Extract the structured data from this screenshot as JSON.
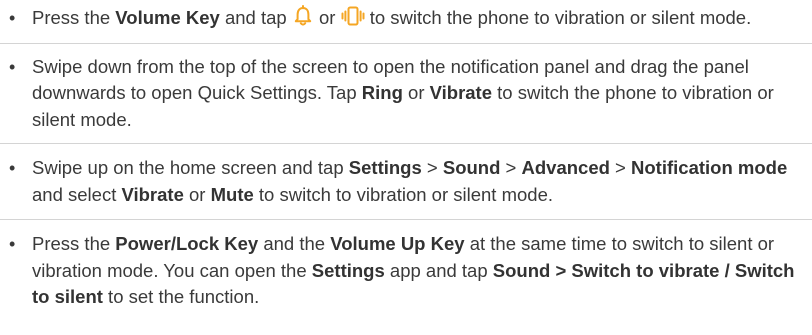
{
  "bullet_glyph": "•",
  "icons": {
    "bell": "bell-icon",
    "vibrate": "vibrate-icon",
    "accent_color": "#f5a623"
  },
  "items": [
    {
      "t1": "Press the ",
      "b1": "Volume Key",
      "t2": " and tap ",
      "t3": " or ",
      "t4": " to switch the phone to vibration or silent mode."
    },
    {
      "t1": "Swipe down from the top of the screen to open the notification panel and drag the panel downwards to open Quick Settings. Tap ",
      "b1": "Ring",
      "t2": " or ",
      "b2": "Vibrate",
      "t3": " to switch the phone to vibration or silent mode."
    },
    {
      "t1": "Swipe up on the home screen and tap ",
      "b1": "Settings",
      "t2": " > ",
      "b2": "Sound",
      "t3": " > ",
      "b3": "Advanced",
      "t4": " > ",
      "b4": "Notification mode",
      "t5": " and select ",
      "b5": "Vibrate",
      "t6": " or ",
      "b6": "Mute",
      "t7": " to switch to vibration or silent mode."
    },
    {
      "t1": "Press the ",
      "b1": "Power/Lock Key",
      "t2": " and the ",
      "b2": "Volume Up Key",
      "t3": " at the same time to switch to silent or vibration mode. You can open the ",
      "b3": "Settings",
      "t4": " app and tap ",
      "b4": "Sound > Switch to vibrate / Switch to silent",
      "t5": " to set the function."
    }
  ]
}
